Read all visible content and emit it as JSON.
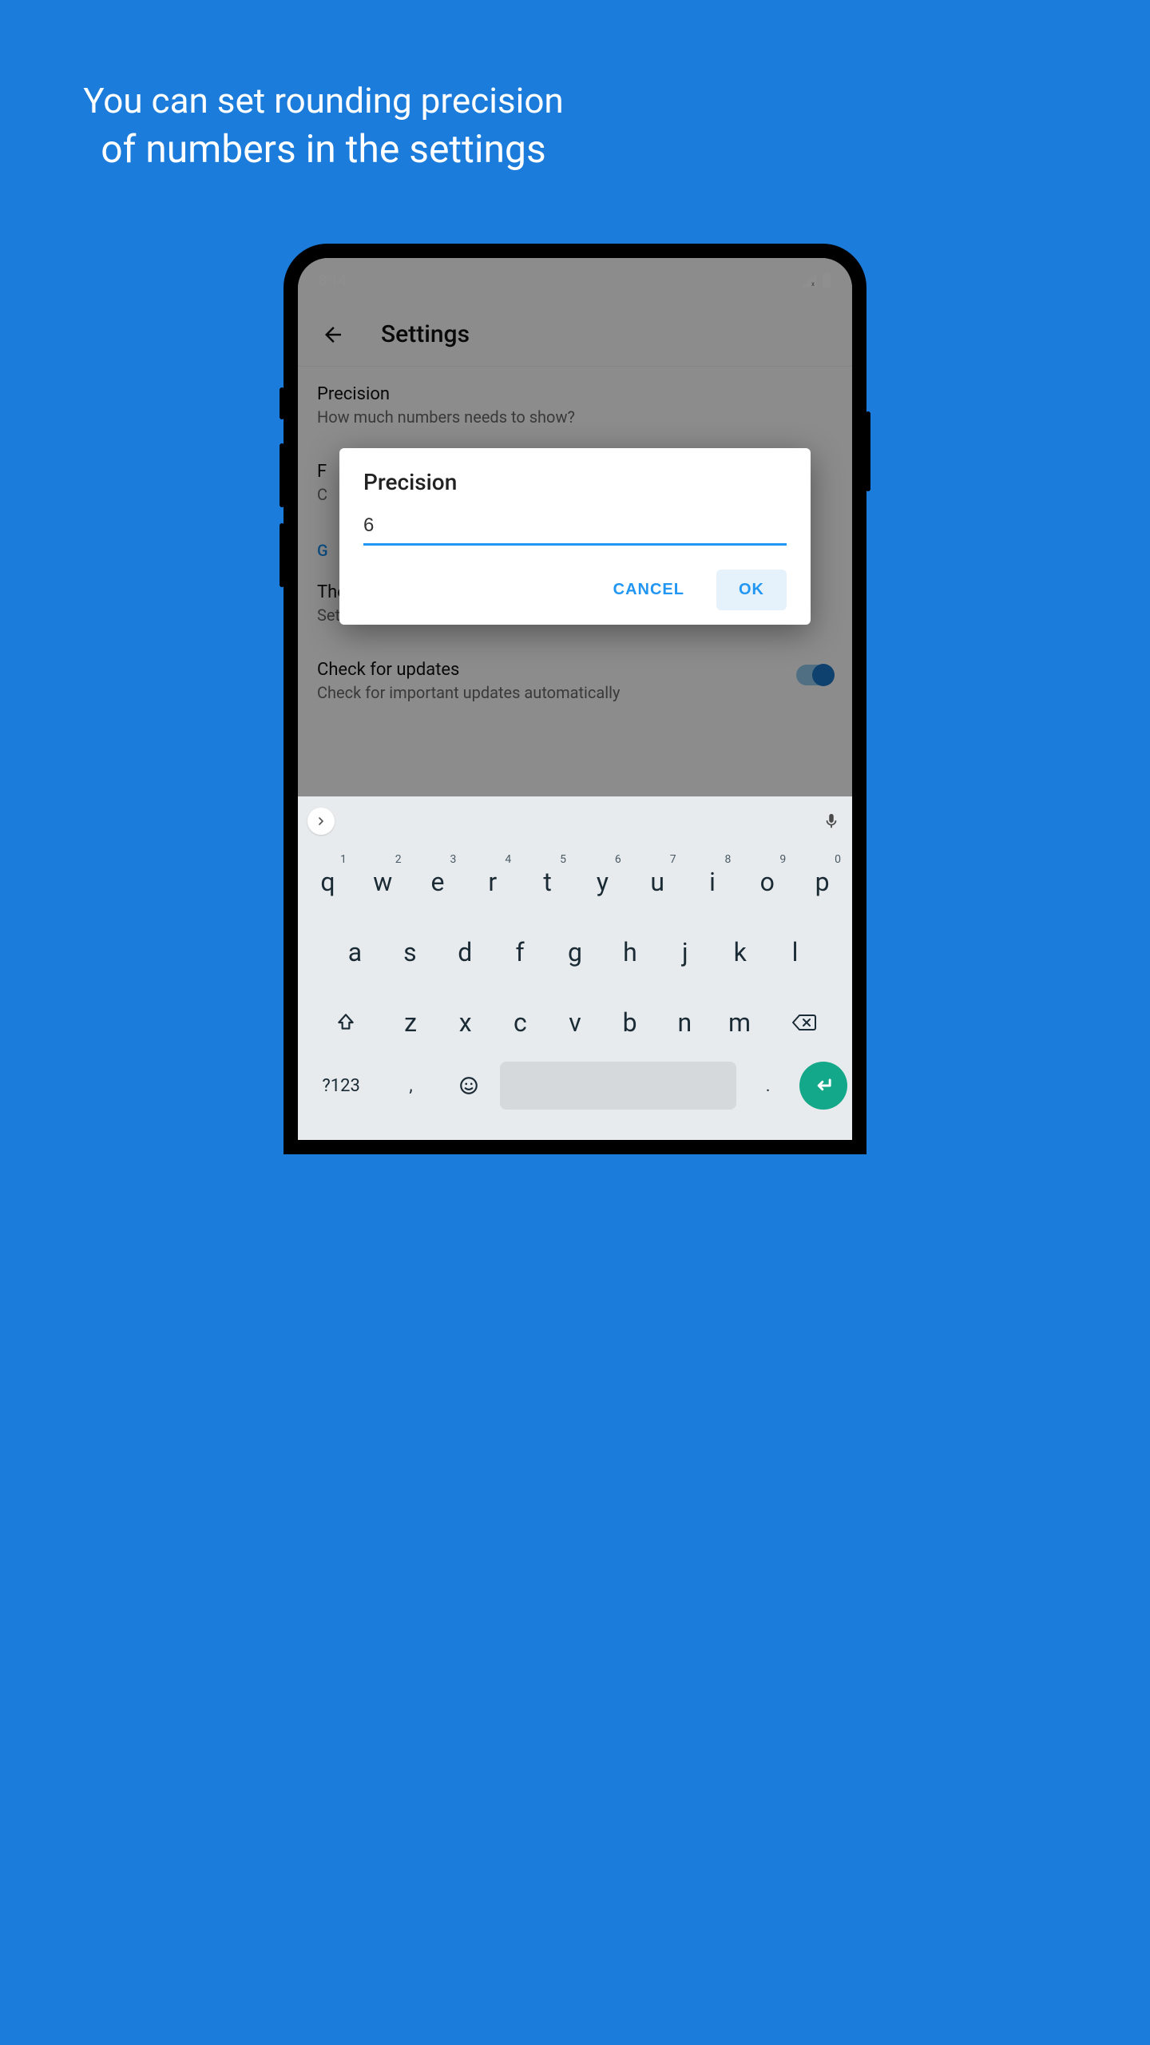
{
  "promo": {
    "line1": "You can set rounding precision",
    "line2": "of numbers in the settings"
  },
  "status": {
    "time": "8:14"
  },
  "appbar": {
    "title": "Settings"
  },
  "settings": {
    "precision": {
      "title": "Precision",
      "sub": "How much numbers needs to show?"
    },
    "format": {
      "title": "F",
      "sub": "C"
    },
    "section": "G",
    "theme": {
      "title": "Theme",
      "sub": "Set the theme"
    },
    "updates": {
      "title": "Check for updates",
      "sub": "Check for important updates automatically"
    }
  },
  "dialog": {
    "title": "Precision",
    "value": "6",
    "cancel": "CANCEL",
    "ok": "OK"
  },
  "keyboard": {
    "row1": [
      {
        "k": "q",
        "h": "1"
      },
      {
        "k": "w",
        "h": "2"
      },
      {
        "k": "e",
        "h": "3"
      },
      {
        "k": "r",
        "h": "4"
      },
      {
        "k": "t",
        "h": "5"
      },
      {
        "k": "y",
        "h": "6"
      },
      {
        "k": "u",
        "h": "7"
      },
      {
        "k": "i",
        "h": "8"
      },
      {
        "k": "o",
        "h": "9"
      },
      {
        "k": "p",
        "h": "0"
      }
    ],
    "row2": [
      "a",
      "s",
      "d",
      "f",
      "g",
      "h",
      "j",
      "k",
      "l"
    ],
    "row3": [
      "z",
      "x",
      "c",
      "v",
      "b",
      "n",
      "m"
    ],
    "symbols": "?123",
    "comma": ",",
    "period": "."
  }
}
